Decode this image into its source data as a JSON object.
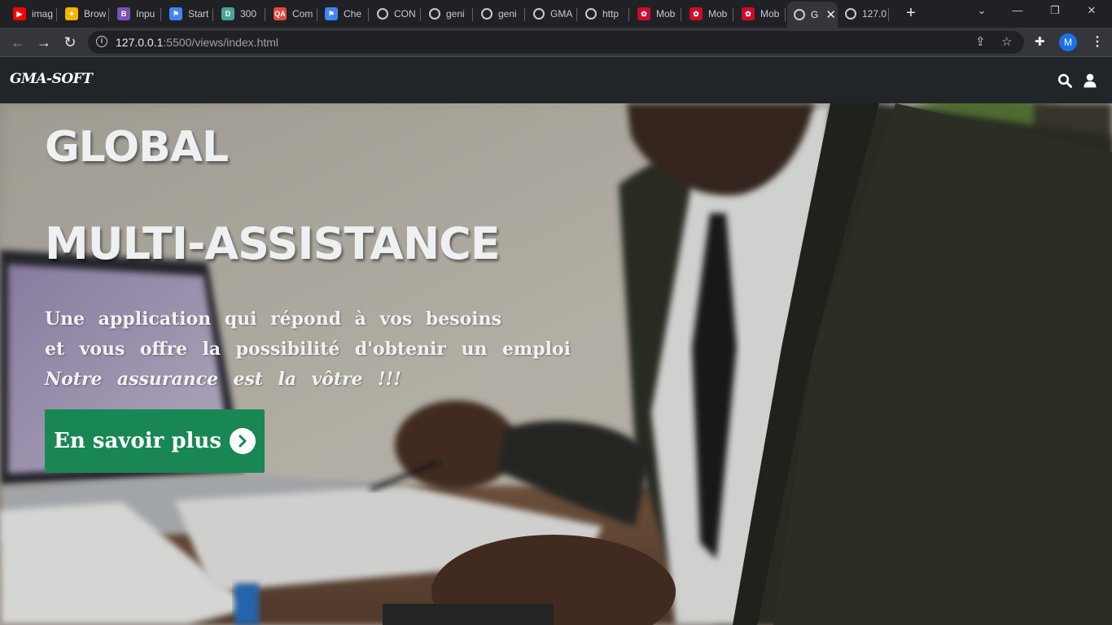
{
  "browser": {
    "tabs": [
      {
        "title": "imag",
        "favicon": "youtube-icon",
        "color": "#ff0000",
        "glyph": "▶"
      },
      {
        "title": "Brow",
        "favicon": "colorful-grid-icon",
        "color": "#f4b400",
        "glyph": "✦"
      },
      {
        "title": "Inpu",
        "favicon": "bootstrap-icon",
        "color": "#7952b3",
        "glyph": "B"
      },
      {
        "title": "Start",
        "favicon": "flag-icon",
        "color": "#4285f4",
        "glyph": "⚑"
      },
      {
        "title": "300",
        "favicon": "d-icon",
        "color": "#4aa39a",
        "glyph": "D"
      },
      {
        "title": "Com",
        "favicon": "qa-icon",
        "color": "#e8473f",
        "glyph": "QA"
      },
      {
        "title": "Che",
        "favicon": "flag-icon",
        "color": "#4285f4",
        "glyph": "⚑"
      },
      {
        "title": "CON",
        "favicon": "globe-icon",
        "color": "#5f6368",
        "glyph": "◍"
      },
      {
        "title": "geni",
        "favicon": "globe-icon",
        "color": "#5f6368",
        "glyph": "◍"
      },
      {
        "title": "geni",
        "favicon": "globe-icon",
        "color": "#5f6368",
        "glyph": "◍"
      },
      {
        "title": "GMA",
        "favicon": "globe-icon",
        "color": "#5f6368",
        "glyph": "◍"
      },
      {
        "title": "http",
        "favicon": "globe-icon",
        "color": "#5f6368",
        "glyph": "◍"
      },
      {
        "title": "Mob",
        "favicon": "huawei-icon",
        "color": "#cf0a2c",
        "glyph": "✿"
      },
      {
        "title": "Mob",
        "favicon": "huawei-icon",
        "color": "#cf0a2c",
        "glyph": "✿"
      },
      {
        "title": "Mob",
        "favicon": "huawei-icon",
        "color": "#cf0a2c",
        "glyph": "✿"
      },
      {
        "title": "G",
        "favicon": "globe-icon",
        "color": "#5f6368",
        "glyph": "◍",
        "active": true
      },
      {
        "title": "127.0",
        "favicon": "globe-icon",
        "color": "#5f6368",
        "glyph": "◍"
      }
    ],
    "url_host": "127.0.0.1",
    "url_rest": ":5500/views/index.html",
    "profile_initial": "M"
  },
  "site": {
    "brand": "GMA-SOFT",
    "hero": {
      "title_line1": "GLOBAL",
      "title_line2": "MULTI-ASSISTANCE",
      "tagline1": "Une application qui répond à vos besoins",
      "tagline2": "et vous offre la possibilité d'obtenir un emploi",
      "tagline3": "Notre assurance est la vôtre !!!",
      "cta_label": "En savoir plus"
    }
  },
  "colors": {
    "navbar": "#212529",
    "cta": "#198754",
    "chrome_dark": "#202124",
    "chrome_toolbar": "#35363a"
  }
}
